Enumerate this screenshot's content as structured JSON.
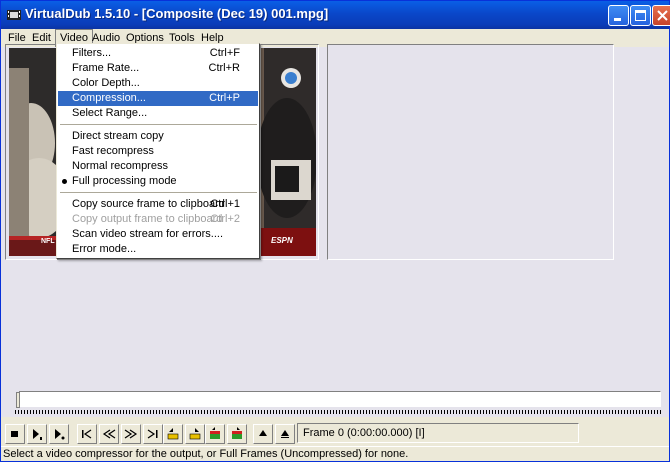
{
  "window": {
    "title": "VirtualDub 1.5.10 - [Composite (Dec 19) 001.mpg]"
  },
  "menubar": {
    "items": [
      {
        "label": "File"
      },
      {
        "label": "Edit"
      },
      {
        "label": "Video"
      },
      {
        "label": "Audio"
      },
      {
        "label": "Options"
      },
      {
        "label": "Tools"
      },
      {
        "label": "Help"
      }
    ]
  },
  "video_menu": {
    "items": [
      {
        "label": "Filters...",
        "accel": "Ctrl+F"
      },
      {
        "label": "Frame Rate...",
        "accel": "Ctrl+R"
      },
      {
        "label": "Color Depth...",
        "accel": ""
      },
      {
        "label": "Compression...",
        "accel": "Ctrl+P",
        "highlighted": true
      },
      {
        "label": "Select Range...",
        "accel": ""
      },
      {
        "label": "Direct stream copy",
        "accel": ""
      },
      {
        "label": "Fast recompress",
        "accel": ""
      },
      {
        "label": "Normal recompress",
        "accel": ""
      },
      {
        "label": "Full processing mode",
        "accel": "",
        "checked": true
      },
      {
        "label": "Copy source frame to clipboard",
        "accel": "Ctrl+1"
      },
      {
        "label": "Copy output frame to clipboard",
        "accel": "Ctrl+2",
        "disabled": true
      },
      {
        "label": "Scan video stream for errors....",
        "accel": ""
      },
      {
        "label": "Error mode...",
        "accel": ""
      }
    ]
  },
  "video_overlay": {
    "logo_left": "NFL",
    "logo_right": "ESPN"
  },
  "position": {
    "frame_text": "Frame 0 (0:00:00.000) [I]"
  },
  "status": {
    "text": "Select a video compressor for the output, or Full Frames (Uncompressed) for none."
  },
  "icons": {
    "title": "virtualdub-film-icon",
    "minimize": "minimize-icon",
    "maximize": "maximize-icon",
    "close": "close-icon"
  }
}
